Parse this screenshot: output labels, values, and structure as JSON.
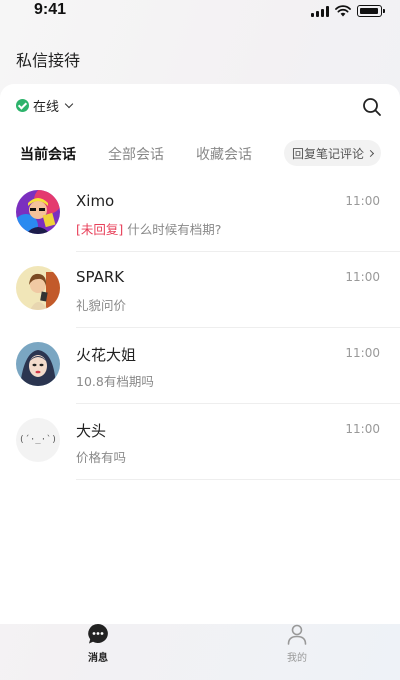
{
  "status_bar": {
    "time": "9:41"
  },
  "page_title": "私信接待",
  "status": {
    "label": "在线",
    "color": "#2db36b"
  },
  "tabs": [
    {
      "label": "当前会话",
      "active": true
    },
    {
      "label": "全部会话",
      "active": false
    },
    {
      "label": "收藏会话",
      "active": false
    }
  ],
  "reply_comments_label": "回复笔记评论",
  "conversations": [
    {
      "name": "Ximo",
      "tag": "[未回复]",
      "message": "什么时候有档期?",
      "time": "11:00"
    },
    {
      "name": "SPARK",
      "tag": "",
      "message": "礼貌问价",
      "time": "11:00"
    },
    {
      "name": "火花大姐",
      "tag": "",
      "message": "10.8有档期吗",
      "time": "11:00"
    },
    {
      "name": "大头",
      "tag": "",
      "message": "价格有吗",
      "time": "11:00",
      "avatar_text": "(´·_·`)"
    }
  ],
  "bottom_nav": [
    {
      "label": "消息",
      "active": true
    },
    {
      "label": "我的",
      "active": false
    }
  ],
  "colors": {
    "accent_red": "#e8405a",
    "online_green": "#2db36b"
  }
}
